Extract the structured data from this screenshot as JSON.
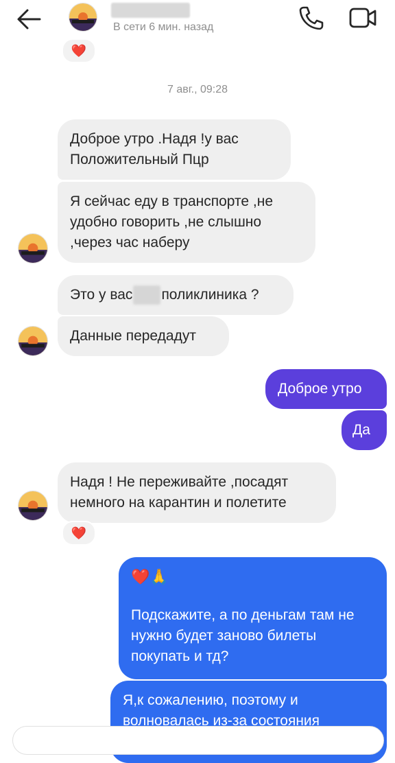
{
  "header": {
    "status": "В сети 6 мин. назад",
    "back_icon": "back-arrow-icon",
    "call_icon": "phone-icon",
    "video_icon": "video-camera-icon"
  },
  "date_separator": "7 авг., 09:28",
  "messages": {
    "m1": "Доброе утро .Надя !у вас Положительный Пцр",
    "m2": "Я сейчас еду в транспорте ,не удобно говорить ,не слышно ,через час наберу",
    "m3_pre": "Это у вас",
    "m3_post": "поликлиника ?",
    "m4": "Данные передадут",
    "m5": "Доброе утро",
    "m6": "Да",
    "m7": "Надя ! Не переживайте ,посадят немного на карантин и полетите",
    "m8_emoji": "❤️🙏",
    "m8_text": "Подскажите,  а по деньгам там не нужно будет заново билеты покупать и тд?",
    "m9": "Я,к сожалению, поэтому и волновалась из-за состояния"
  },
  "reactions": {
    "heart": "❤️"
  },
  "colors": {
    "incoming": "#efefef",
    "outgoing_purple": "#5b3fdc",
    "outgoing_blue": "#2f6cf0",
    "muted": "#8e8e8e"
  }
}
